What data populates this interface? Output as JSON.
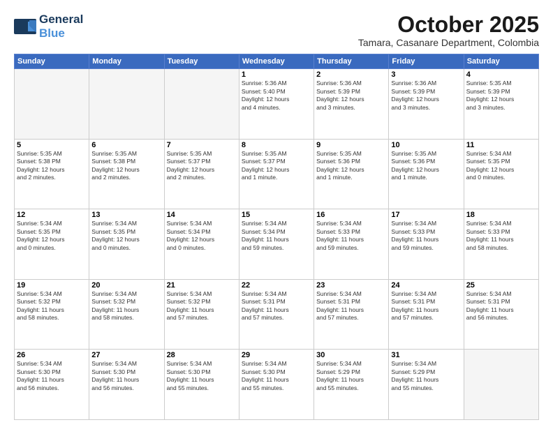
{
  "header": {
    "logo_general": "General",
    "logo_blue": "Blue",
    "month": "October 2025",
    "location": "Tamara, Casanare Department, Colombia"
  },
  "weekdays": [
    "Sunday",
    "Monday",
    "Tuesday",
    "Wednesday",
    "Thursday",
    "Friday",
    "Saturday"
  ],
  "weeks": [
    [
      {
        "day": "",
        "info": ""
      },
      {
        "day": "",
        "info": ""
      },
      {
        "day": "",
        "info": ""
      },
      {
        "day": "1",
        "info": "Sunrise: 5:36 AM\nSunset: 5:40 PM\nDaylight: 12 hours\nand 4 minutes."
      },
      {
        "day": "2",
        "info": "Sunrise: 5:36 AM\nSunset: 5:39 PM\nDaylight: 12 hours\nand 3 minutes."
      },
      {
        "day": "3",
        "info": "Sunrise: 5:36 AM\nSunset: 5:39 PM\nDaylight: 12 hours\nand 3 minutes."
      },
      {
        "day": "4",
        "info": "Sunrise: 5:35 AM\nSunset: 5:39 PM\nDaylight: 12 hours\nand 3 minutes."
      }
    ],
    [
      {
        "day": "5",
        "info": "Sunrise: 5:35 AM\nSunset: 5:38 PM\nDaylight: 12 hours\nand 2 minutes."
      },
      {
        "day": "6",
        "info": "Sunrise: 5:35 AM\nSunset: 5:38 PM\nDaylight: 12 hours\nand 2 minutes."
      },
      {
        "day": "7",
        "info": "Sunrise: 5:35 AM\nSunset: 5:37 PM\nDaylight: 12 hours\nand 2 minutes."
      },
      {
        "day": "8",
        "info": "Sunrise: 5:35 AM\nSunset: 5:37 PM\nDaylight: 12 hours\nand 1 minute."
      },
      {
        "day": "9",
        "info": "Sunrise: 5:35 AM\nSunset: 5:36 PM\nDaylight: 12 hours\nand 1 minute."
      },
      {
        "day": "10",
        "info": "Sunrise: 5:35 AM\nSunset: 5:36 PM\nDaylight: 12 hours\nand 1 minute."
      },
      {
        "day": "11",
        "info": "Sunrise: 5:34 AM\nSunset: 5:35 PM\nDaylight: 12 hours\nand 0 minutes."
      }
    ],
    [
      {
        "day": "12",
        "info": "Sunrise: 5:34 AM\nSunset: 5:35 PM\nDaylight: 12 hours\nand 0 minutes."
      },
      {
        "day": "13",
        "info": "Sunrise: 5:34 AM\nSunset: 5:35 PM\nDaylight: 12 hours\nand 0 minutes."
      },
      {
        "day": "14",
        "info": "Sunrise: 5:34 AM\nSunset: 5:34 PM\nDaylight: 12 hours\nand 0 minutes."
      },
      {
        "day": "15",
        "info": "Sunrise: 5:34 AM\nSunset: 5:34 PM\nDaylight: 11 hours\nand 59 minutes."
      },
      {
        "day": "16",
        "info": "Sunrise: 5:34 AM\nSunset: 5:33 PM\nDaylight: 11 hours\nand 59 minutes."
      },
      {
        "day": "17",
        "info": "Sunrise: 5:34 AM\nSunset: 5:33 PM\nDaylight: 11 hours\nand 59 minutes."
      },
      {
        "day": "18",
        "info": "Sunrise: 5:34 AM\nSunset: 5:33 PM\nDaylight: 11 hours\nand 58 minutes."
      }
    ],
    [
      {
        "day": "19",
        "info": "Sunrise: 5:34 AM\nSunset: 5:32 PM\nDaylight: 11 hours\nand 58 minutes."
      },
      {
        "day": "20",
        "info": "Sunrise: 5:34 AM\nSunset: 5:32 PM\nDaylight: 11 hours\nand 58 minutes."
      },
      {
        "day": "21",
        "info": "Sunrise: 5:34 AM\nSunset: 5:32 PM\nDaylight: 11 hours\nand 57 minutes."
      },
      {
        "day": "22",
        "info": "Sunrise: 5:34 AM\nSunset: 5:31 PM\nDaylight: 11 hours\nand 57 minutes."
      },
      {
        "day": "23",
        "info": "Sunrise: 5:34 AM\nSunset: 5:31 PM\nDaylight: 11 hours\nand 57 minutes."
      },
      {
        "day": "24",
        "info": "Sunrise: 5:34 AM\nSunset: 5:31 PM\nDaylight: 11 hours\nand 57 minutes."
      },
      {
        "day": "25",
        "info": "Sunrise: 5:34 AM\nSunset: 5:31 PM\nDaylight: 11 hours\nand 56 minutes."
      }
    ],
    [
      {
        "day": "26",
        "info": "Sunrise: 5:34 AM\nSunset: 5:30 PM\nDaylight: 11 hours\nand 56 minutes."
      },
      {
        "day": "27",
        "info": "Sunrise: 5:34 AM\nSunset: 5:30 PM\nDaylight: 11 hours\nand 56 minutes."
      },
      {
        "day": "28",
        "info": "Sunrise: 5:34 AM\nSunset: 5:30 PM\nDaylight: 11 hours\nand 55 minutes."
      },
      {
        "day": "29",
        "info": "Sunrise: 5:34 AM\nSunset: 5:30 PM\nDaylight: 11 hours\nand 55 minutes."
      },
      {
        "day": "30",
        "info": "Sunrise: 5:34 AM\nSunset: 5:29 PM\nDaylight: 11 hours\nand 55 minutes."
      },
      {
        "day": "31",
        "info": "Sunrise: 5:34 AM\nSunset: 5:29 PM\nDaylight: 11 hours\nand 55 minutes."
      },
      {
        "day": "",
        "info": ""
      }
    ]
  ]
}
